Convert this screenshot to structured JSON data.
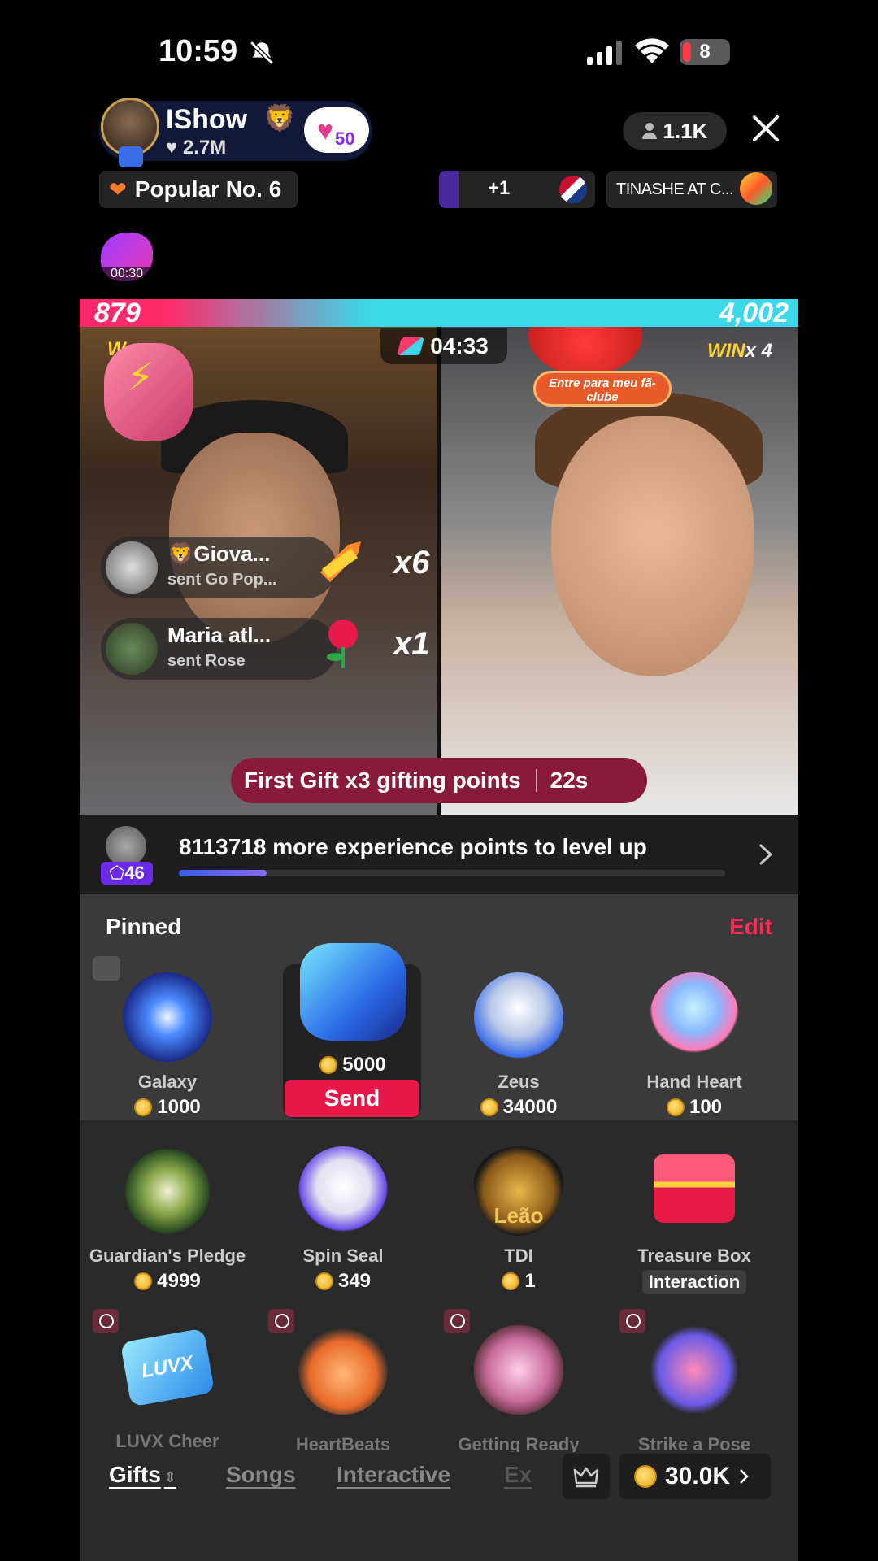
{
  "status": {
    "time": "10:59",
    "battery": "8"
  },
  "host": {
    "name": "IShow",
    "emoji": "🦁",
    "likes": "2.7M",
    "level": "50"
  },
  "viewers": "1.1K",
  "popular": "Popular No. 6",
  "guests": {
    "plus": "+1",
    "song": "TINASHE AT C..."
  },
  "timer_badge": "00:30",
  "battle": {
    "left_score": "879",
    "right_score": "4,002",
    "countdown": "04:33",
    "win_label": "WIN",
    "win_count": "x 4",
    "left_win_label": "W",
    "fanclub_label": "Entre para meu fã-clube"
  },
  "gift_feed": [
    {
      "name": "Giova...",
      "emoji": "🦁",
      "sent": "sent Go Pop...",
      "mult": "x6"
    },
    {
      "name": "Maria atl...",
      "emoji": "",
      "sent": "sent Rose",
      "mult": "x1"
    }
  ],
  "first_gift": {
    "text": "First Gift x3 gifting points",
    "time": "22s"
  },
  "levelup": {
    "badge": "46",
    "points": "8113718",
    "text": " more experience points to level up",
    "progress": 0.16
  },
  "pinned": {
    "title": "Pinned",
    "edit": "Edit"
  },
  "pinned_gifts": [
    {
      "name": "Galaxy",
      "price": "1000"
    },
    {
      "name": "",
      "price": "5000",
      "action": "Send"
    },
    {
      "name": "Zeus",
      "price": "34000"
    },
    {
      "name": "Hand Heart",
      "price": "100"
    }
  ],
  "gifts_row2": [
    {
      "name": "Guardian's Pledge",
      "price": "4999"
    },
    {
      "name": "Spin Seal",
      "price": "349"
    },
    {
      "name": "TDI",
      "price": "1",
      "icon_text": "Leão"
    },
    {
      "name": "Treasure Box",
      "price": "Interaction"
    }
  ],
  "gifts_row3": [
    {
      "name": "LUVX Cheer",
      "icon_text": "LUVX"
    },
    {
      "name": "HeartBeats"
    },
    {
      "name": "Getting Ready"
    },
    {
      "name": "Strike a Pose"
    }
  ],
  "tabs": [
    "Gifts",
    "Songs",
    "Interactive",
    "Ex"
  ],
  "balance": "30.0K",
  "colors": {
    "accent": "#e8174a",
    "edit": "#ff2a5a",
    "level_badge": "#6a2ae8",
    "battle_left": "#ff2a6a",
    "battle_right": "#3ad8e8"
  }
}
